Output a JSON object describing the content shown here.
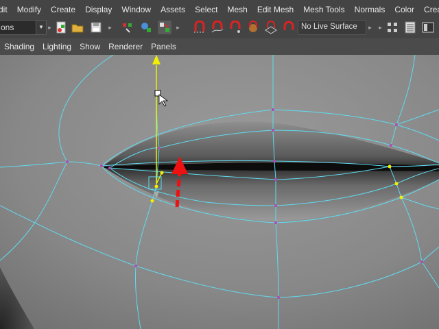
{
  "menubar": {
    "items": [
      "dit",
      "Modify",
      "Create",
      "Display",
      "Window",
      "Assets",
      "Select",
      "Mesh",
      "Edit Mesh",
      "Mesh Tools",
      "Normals",
      "Color",
      "Create UVs"
    ]
  },
  "toolbar": {
    "mode_value": "ons",
    "live_surface": "No Live Surface"
  },
  "panel_menu": {
    "items": [
      "Shading",
      "Lighting",
      "Show",
      "Renderer",
      "Panels"
    ]
  },
  "icons": [
    "dropdown-arrow-icon",
    "select-by-hierarchy-icon",
    "open-scene-icon",
    "save-scene-icon",
    "select-by-component-icon",
    "select-by-object-icon",
    "highlight-component-icon",
    "snap-to-grid-icon",
    "snap-to-curve-icon",
    "snap-to-point-icon",
    "snap-to-projected-center-icon",
    "snap-to-view-plane-icon",
    "make-live-icon",
    "history-icon",
    "render-settings-icon",
    "render-view-icon"
  ],
  "colors": {
    "wireframe": "#5fdcf0",
    "vertex": "#b04ab8",
    "selected_vertex": "#f5f000",
    "manipulator": "#f0f000",
    "annotation_arrow": "#ee1111"
  }
}
